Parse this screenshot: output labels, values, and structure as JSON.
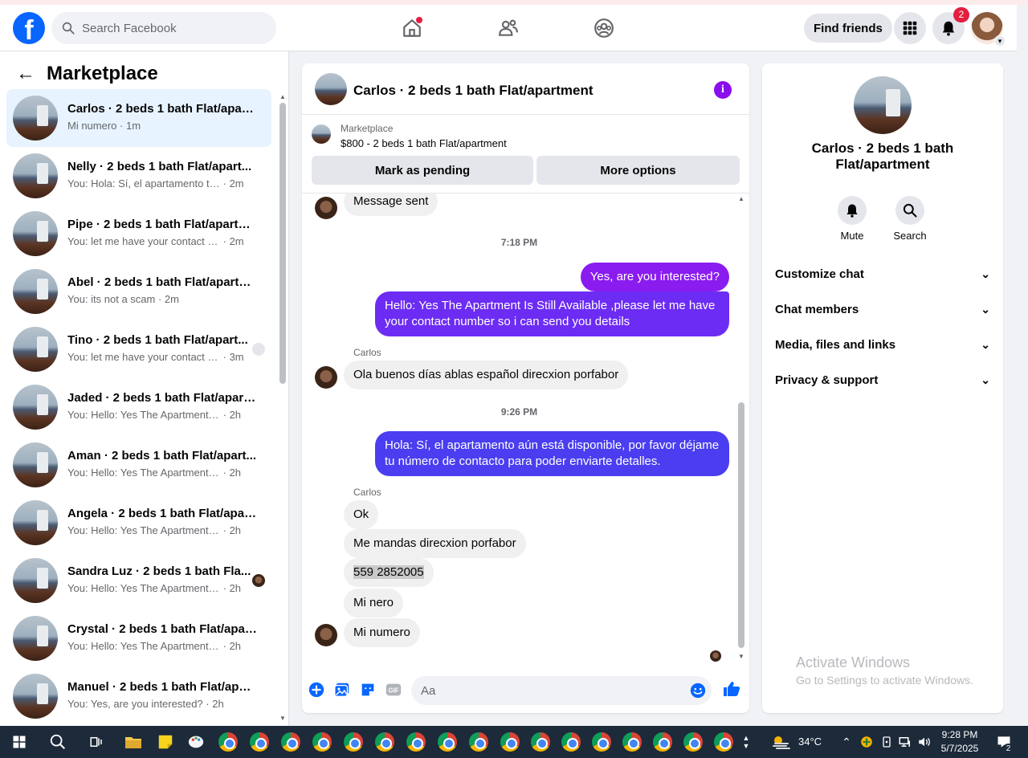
{
  "header": {
    "logo": "f",
    "search_placeholder": "Search Facebook",
    "find_friends": "Find friends",
    "notif_count": "2"
  },
  "left": {
    "title": "Marketplace",
    "conversations": [
      {
        "name": "Carlos · 2 beds 1 bath Flat/apart...",
        "preview": "Mi numero",
        "time": "· 1m",
        "active": true
      },
      {
        "name": "Nelly · 2 beds 1 bath Flat/apart...",
        "preview": "You: Hola: Sí, el apartamento todav...",
        "time": "· 2m"
      },
      {
        "name": "Pipe · 2 beds 1 bath Flat/apartm...",
        "preview": "You: let me have your contact nu...",
        "time": "· 2m"
      },
      {
        "name": "Abel · 2 beds 1 bath Flat/apartm...",
        "preview": "You: its not a scam",
        "time": "· 2m"
      },
      {
        "name": "Tino · 2 beds 1 bath Flat/apart...",
        "preview": "You: let me have your contact n...",
        "time": "· 3m"
      },
      {
        "name": "Jaded · 2 beds 1 bath Flat/apart...",
        "preview": "You: Hello: Yes The Apartment Is Sti...",
        "time": "· 2h"
      },
      {
        "name": "Aman · 2 beds 1 bath Flat/apart...",
        "preview": "You: Hello: Yes The Apartment Is Sti...",
        "time": "· 2h"
      },
      {
        "name": "Angela · 2 beds 1 bath Flat/apart...",
        "preview": "You: Hello: Yes The Apartment Is Sti...",
        "time": "· 2h"
      },
      {
        "name": "Sandra Luz · 2 beds 1 bath Fla...",
        "preview": "You: Hello: Yes The Apartment Is ...",
        "time": "· 2h"
      },
      {
        "name": "Crystal · 2 beds 1 bath Flat/apart...",
        "preview": "You: Hello: Yes The Apartment Is Sti...",
        "time": "· 2h"
      },
      {
        "name": "Manuel · 2 beds 1 bath Flat/apar...",
        "preview": "You: Yes, are you interested?",
        "time": "· 2h"
      }
    ]
  },
  "chat": {
    "title": "Carlos · 2 beds 1 bath Flat/apartment",
    "listing_label": "Marketplace",
    "listing_price": "$800 - 2 beds 1 bath Flat/apartment",
    "mark_pending": "Mark as pending",
    "more_options": "More options",
    "messages": {
      "m1": "Message sent",
      "t1": "7:18 PM",
      "m2": "Yes, are you interested?",
      "m3a": "Hello: Yes The Apartment Is Still Available ,please let me have",
      "m3b": "your contact number so i can send you details",
      "s1": "Carlos",
      "m4": "Ola buenos días ablas español  direcxion porfabor",
      "t2": "9:26 PM",
      "m5a": "Hola: Sí, el apartamento aún está disponible, por favor déjame",
      "m5b": "tu número de contacto para poder enviarte detalles.",
      "s2": "Carlos",
      "m6": "Ok",
      "m7": "Me mandas direcxion porfabor",
      "m8": "559 2852005",
      "m9": "Mi nero",
      "m10": "Mi numero"
    },
    "input_placeholder": "Aa",
    "colors": {
      "out_purple": "#8a1cf0",
      "out_violet": "#6c2cf3",
      "out_blue": "#4a3ef0"
    }
  },
  "right": {
    "name": "Carlos · 2 beds 1 bath Flat/apartment",
    "mute": "Mute",
    "search": "Search",
    "sections": [
      "Customize chat",
      "Chat members",
      "Media, files and links",
      "Privacy & support"
    ],
    "watermark_title": "Activate Windows",
    "watermark_sub": "Go to Settings to activate Windows."
  },
  "taskbar": {
    "temp": "34°C",
    "time": "9:28 PM",
    "date": "5/7/2025",
    "action_count": "2"
  }
}
